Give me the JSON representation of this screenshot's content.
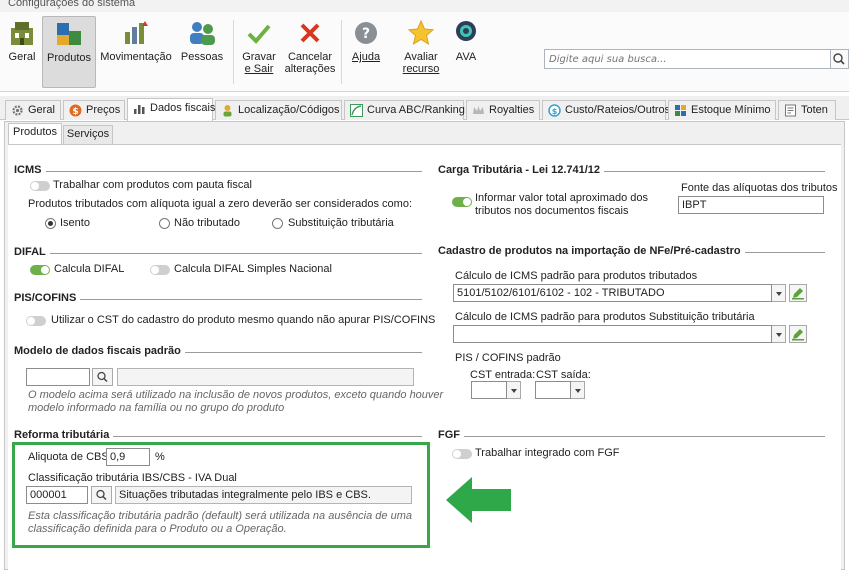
{
  "window": {
    "title": "Configurações do sistema"
  },
  "ribbon": {
    "geral": "Geral",
    "produtos": "Produtos",
    "movimentacao": "Movimentação",
    "pessoas": "Pessoas",
    "gravar_l1": "Gravar",
    "gravar_l2": "e Sair",
    "cancelar_l1": "Cancelar",
    "cancelar_l2": "alterações",
    "ajuda": "Ajuda",
    "avaliar_l1": "Avaliar",
    "avaliar_l2": "recurso",
    "ava": "AVA",
    "search_placeholder": "Digite aqui sua busca..."
  },
  "tabs": [
    "Geral",
    "Preços",
    "Dados fiscais",
    "Localização/Códigos",
    "Curva ABC/Ranking",
    "Royalties",
    "Custo/Rateios/Outros",
    "Estoque Mínimo",
    "Toten"
  ],
  "subtabs": [
    "Produtos",
    "Serviços"
  ],
  "icms": {
    "title": "ICMS",
    "pauta": "Trabalhar com produtos com pauta fiscal",
    "aliquota_zero": "Produtos tributados com alíquota igual a zero deverão ser considerados como:",
    "isento": "Isento",
    "nao_tributado": "Não tributado",
    "substituicao": "Substituição tributária"
  },
  "difal": {
    "title": "DIFAL",
    "calcula": "Calcula DIFAL",
    "simples": "Calcula DIFAL Simples Nacional"
  },
  "piscofins": {
    "title": "PIS/COFINS",
    "utilizar": "Utilizar o CST do cadastro do produto mesmo quando não apurar PIS/COFINS"
  },
  "modelo": {
    "title": "Modelo de dados fiscais padrão",
    "note_l1": "O modelo acima será utilizado na inclusão de novos produtos, exceto quando houver",
    "note_l2": "modelo informado na família ou no grupo do produto"
  },
  "reforma": {
    "title": "Reforma tributária",
    "aliquota_label": "Aliquota de CBS",
    "aliquota_value": "0,9",
    "percent": "%",
    "classificacao_label": "Classificação tributária IBS/CBS - IVA Dual",
    "codigo": "000001",
    "descricao": "Situações tributadas integralmente pelo IBS e CBS.",
    "note_l1": "Esta classificação tributária padrão (default) será utilizada na ausência de uma",
    "note_l2": "classificação definida para o Produto ou a Operação."
  },
  "carga": {
    "title": "Carga Tributária - Lei 12.741/12",
    "informar_l1": "Informar valor total aproximado dos",
    "informar_l2": "tributos nos documentos fiscais",
    "fonte_label": "Fonte das alíquotas dos tributos",
    "fonte_value": "IBPT"
  },
  "cadastro": {
    "title": "Cadastro de produtos na importação de NFe/Pré-cadastro",
    "icms_trib_label": "Cálculo de ICMS padrão para produtos tributados",
    "icms_trib_value": "5101/5102/6101/6102 - 102 - TRIBUTADO",
    "icms_st_label": "Cálculo de ICMS padrão para produtos Substituição tributária",
    "piscofins_label": "PIS / COFINS padrão",
    "cst_entrada": "CST entrada:",
    "cst_saida": "CST saída:"
  },
  "fgf": {
    "title": "FGF",
    "trabalhar": "Trabalhar integrado com FGF"
  }
}
